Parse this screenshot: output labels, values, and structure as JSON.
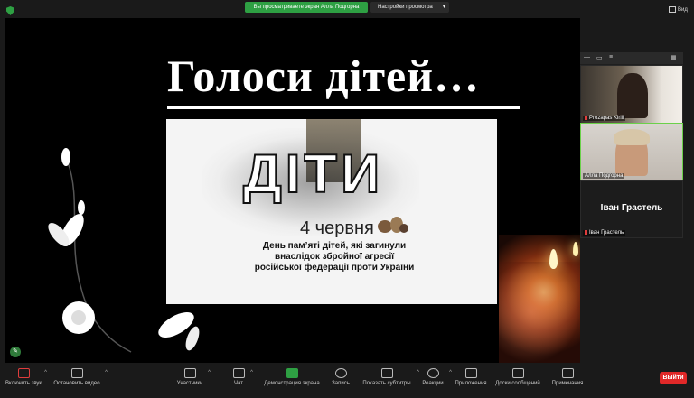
{
  "topbar": {
    "share_text": "Вы просматриваете экран Алла Подгорна",
    "view_options": "Настройки просмотра",
    "view_button": "Вид"
  },
  "slide": {
    "title": "Голоси дітей…",
    "poster": {
      "word": "ДІТИ",
      "date": "4 червня",
      "subtitle_line1": "День пам’яті дітей, які загинули",
      "subtitle_line2": "внаслідок збройної агресії",
      "subtitle_line3": "російської федерації проти України"
    }
  },
  "panel": {
    "participants": [
      {
        "name": "Prozapas Kirill",
        "muted": true
      },
      {
        "name": "Алла Подгорна",
        "muted": false
      },
      {
        "name": "Іван Грастель",
        "display_name": "Іван Грастель",
        "muted": true
      }
    ]
  },
  "toolbar": {
    "items": [
      {
        "label": "Включить звук",
        "icon": "mic-muted-icon"
      },
      {
        "label": "Остановить видео",
        "icon": "video-camera-icon"
      },
      {
        "label": "Участники",
        "icon": "participants-icon"
      },
      {
        "label": "Чат",
        "icon": "chat-icon"
      },
      {
        "label": "Демонстрация экрана",
        "icon": "share-screen-icon"
      },
      {
        "label": "Запись",
        "icon": "record-icon"
      },
      {
        "label": "Показать субтитры",
        "icon": "captions-icon"
      },
      {
        "label": "Реакции",
        "icon": "reactions-icon"
      },
      {
        "label": "Приложения",
        "icon": "apps-icon"
      },
      {
        "label": "Доски сообщений",
        "icon": "whiteboard-icon"
      },
      {
        "label": "Примечания",
        "icon": "notes-icon"
      }
    ],
    "leave_label": "Выйти"
  },
  "colors": {
    "accent_green": "#2ea043",
    "leave_red": "#e02828"
  }
}
